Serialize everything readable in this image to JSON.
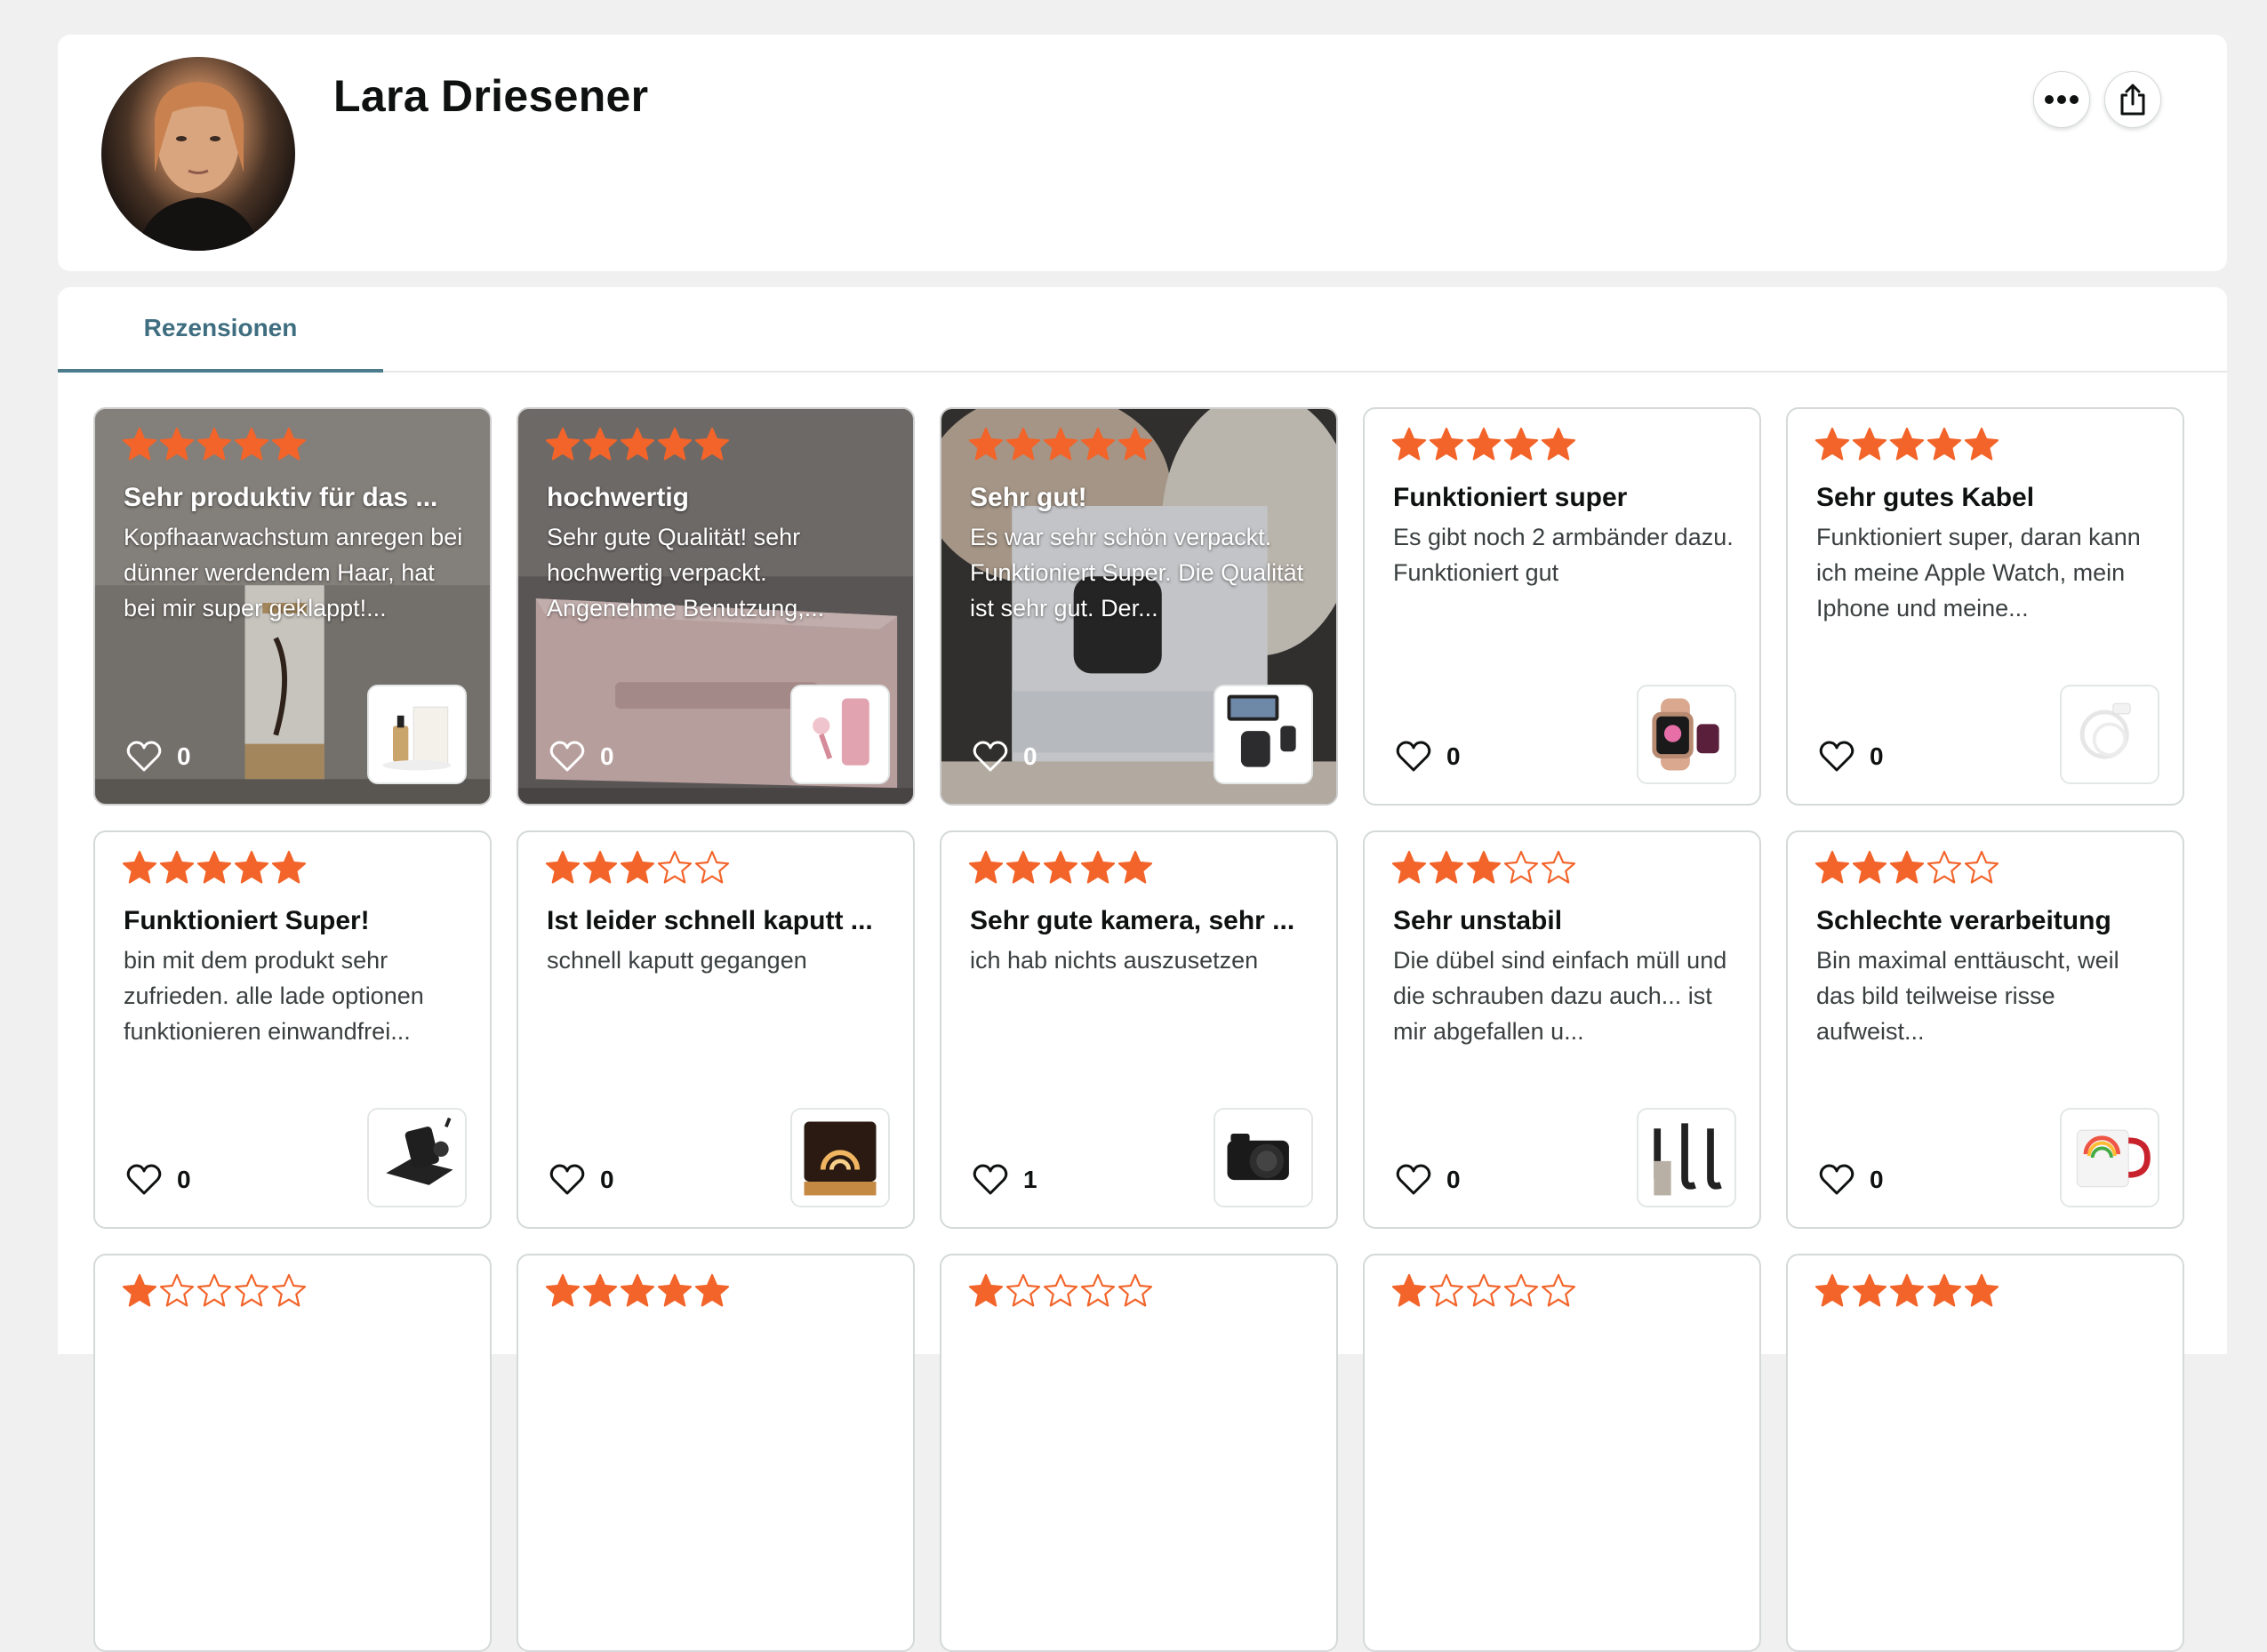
{
  "profile": {
    "name": "Lara Driesener",
    "more_icon": "ellipsis-icon",
    "share_icon": "share-icon"
  },
  "tabs": [
    {
      "label": "Rezensionen",
      "active": true
    }
  ],
  "colors": {
    "star": "#f2642a",
    "tab_accent": "#4c7c8c"
  },
  "reviews": [
    {
      "rating": 5,
      "title": "Sehr produktiv für das ...",
      "body": "Kopfhaarwachstum anregen bei dünner werdendem Haar, hat bei mir super geklappt!...",
      "likes": "0",
      "photo": true,
      "product": "hair-serum"
    },
    {
      "rating": 5,
      "title": "hochwertig",
      "body": "Sehr gute Qualität! sehr hochwertig verpackt. Angenehme Benutzung,...",
      "likes": "0",
      "photo": true,
      "product": "pink-device"
    },
    {
      "rating": 5,
      "title": "Sehr gut!",
      "body": "Es war sehr schön verpackt. Funktioniert Super. Die Qualität ist sehr gut. Der...",
      "likes": "0",
      "photo": true,
      "product": "doorbell"
    },
    {
      "rating": 5,
      "title": "Funktioniert super",
      "body": "Es gibt noch 2 armbänder dazu. Funktioniert gut",
      "likes": "0",
      "photo": false,
      "product": "smartwatch"
    },
    {
      "rating": 5,
      "title": "Sehr gutes Kabel",
      "body": "Funktioniert super, daran kann ich meine Apple Watch, mein Iphone und meine...",
      "likes": "0",
      "photo": false,
      "product": "cable"
    },
    {
      "rating": 5,
      "title": "Funktioniert Super!",
      "body": "bin mit dem produkt sehr zufrieden. alle lade optionen funktionieren einwandfrei...",
      "likes": "0",
      "photo": false,
      "product": "charger"
    },
    {
      "rating": 3,
      "title": "Ist leider schnell kaputt ...",
      "body": "schnell kaputt gegangen",
      "likes": "0",
      "photo": false,
      "product": "lamp"
    },
    {
      "rating": 5,
      "title": "Sehr gute kamera, sehr ...",
      "body": "ich hab nichts auszusetzen",
      "likes": "1",
      "photo": false,
      "product": "camera"
    },
    {
      "rating": 3,
      "title": "Sehr unstabil",
      "body": "Die dübel sind einfach müll und die schrauben dazu auch... ist mir abgefallen u...",
      "likes": "0",
      "photo": false,
      "product": "hooks"
    },
    {
      "rating": 3,
      "title": "Schlechte verarbeitung",
      "body": "Bin maximal enttäuscht, weil das bild teilweise risse aufweist...",
      "likes": "0",
      "photo": false,
      "product": "mug"
    },
    {
      "rating": 1,
      "title": "",
      "body": "",
      "likes": "",
      "photo": false,
      "product": ""
    },
    {
      "rating": 5,
      "title": "",
      "body": "",
      "likes": "",
      "photo": false,
      "product": ""
    },
    {
      "rating": 1,
      "title": "",
      "body": "",
      "likes": "",
      "photo": false,
      "product": ""
    },
    {
      "rating": 1,
      "title": "",
      "body": "",
      "likes": "",
      "photo": false,
      "product": ""
    },
    {
      "rating": 5,
      "title": "",
      "body": "",
      "likes": "",
      "photo": false,
      "product": ""
    }
  ]
}
